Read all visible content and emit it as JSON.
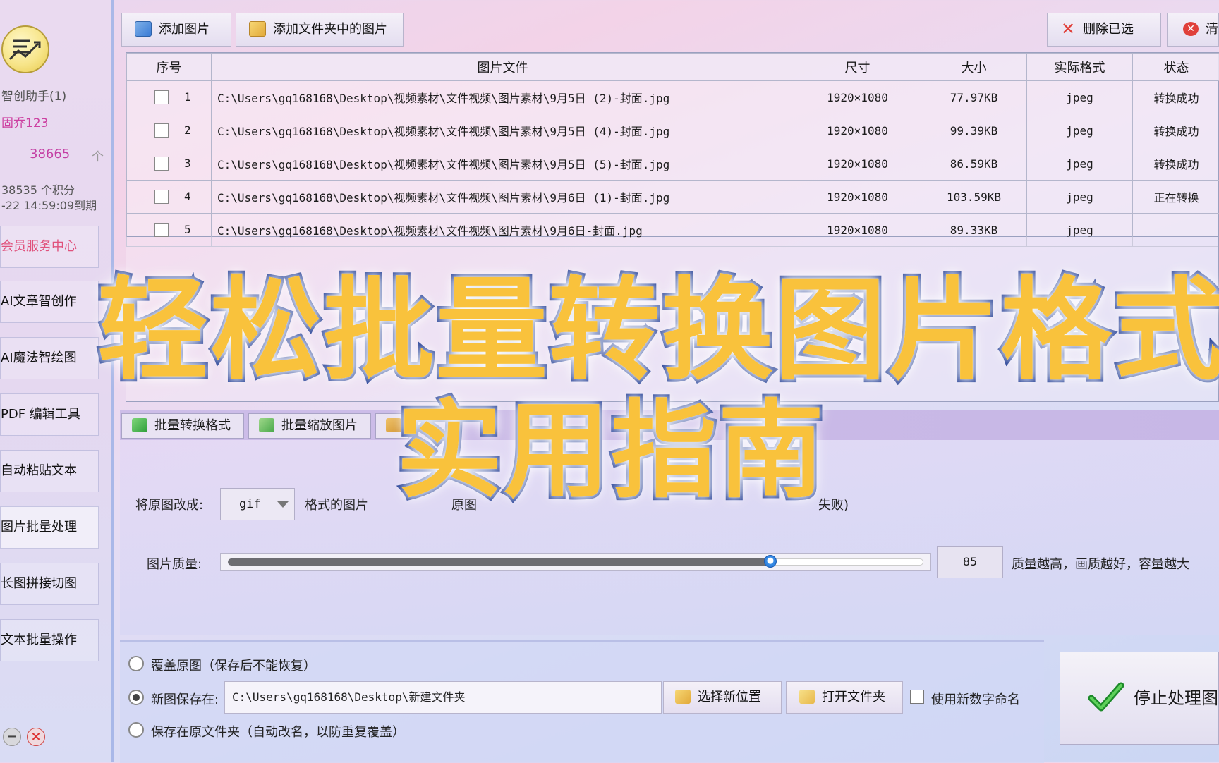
{
  "sidebar": {
    "app_name": "智创助手(1)",
    "user_name": "固乔123",
    "count": "38665",
    "count_unit": "个",
    "points": "38535 个积分",
    "expiry": "-22 14:59:09到期",
    "member_center": "会员服务中心",
    "items": [
      {
        "label": "AI文章智创作"
      },
      {
        "label": "AI魔法智绘图"
      },
      {
        "label": "PDF 编辑工具"
      },
      {
        "label": "自动粘贴文本"
      },
      {
        "label": "图片批量处理"
      },
      {
        "label": "长图拼接切图"
      },
      {
        "label": "文本批量操作"
      }
    ]
  },
  "toolbar": {
    "add_image": "添加图片",
    "add_folder": "添加文件夹中的图片",
    "delete_selected": "删除已选",
    "clear": "清"
  },
  "table": {
    "headers": [
      "序号",
      "图片文件",
      "尺寸",
      "大小",
      "实际格式",
      "状态"
    ],
    "rows": [
      {
        "no": "1",
        "file": "C:\\Users\\gq168168\\Desktop\\视频素材\\文件视频\\图片素材\\9月5日  (2)-封面.jpg",
        "size": "1920×1080",
        "bytes": "77.97KB",
        "format": "jpeg",
        "status": "转换成功"
      },
      {
        "no": "2",
        "file": "C:\\Users\\gq168168\\Desktop\\视频素材\\文件视频\\图片素材\\9月5日  (4)-封面.jpg",
        "size": "1920×1080",
        "bytes": "99.39KB",
        "format": "jpeg",
        "status": "转换成功"
      },
      {
        "no": "3",
        "file": "C:\\Users\\gq168168\\Desktop\\视频素材\\文件视频\\图片素材\\9月5日  (5)-封面.jpg",
        "size": "1920×1080",
        "bytes": "86.59KB",
        "format": "jpeg",
        "status": "转换成功"
      },
      {
        "no": "4",
        "file": "C:\\Users\\gq168168\\Desktop\\视频素材\\文件视频\\图片素材\\9月6日  (1)-封面.jpg",
        "size": "1920×1080",
        "bytes": "103.59KB",
        "format": "jpeg",
        "status": "正在转换"
      },
      {
        "no": "5",
        "file": "C:\\Users\\gq168168\\Desktop\\视频素材\\文件视频\\图片素材\\9月6日-封面.jpg",
        "size": "1920×1080",
        "bytes": "89.33KB",
        "format": "jpeg",
        "status": ""
      }
    ]
  },
  "tabs": {
    "batch_convert": "批量转换格式",
    "batch_resize": "批量缩放图片"
  },
  "settings": {
    "convert_label": "将原图改成:",
    "format_value": "gif",
    "format_suffix": "格式的图片",
    "partial_note_left": "原图",
    "partial_note_right": "失败)",
    "quality_label": "图片质量:",
    "quality_value": "85",
    "quality_fraction": 0.78,
    "quality_hint": "质量越高，画质越好，容量越大"
  },
  "save": {
    "overwrite": "覆盖原图（保存后不能恢复）",
    "save_new_label": "新图保存在:",
    "save_path": "C:\\Users\\gq168168\\Desktop\\新建文件夹",
    "choose_location": "选择新位置",
    "open_folder": "打开文件夹",
    "use_number_name": "使用新数字命名",
    "save_original": "保存在原文件夹（自动改名，以防重复覆盖）",
    "stop_button": "停止处理图"
  },
  "overlay": {
    "line1": "轻松批量转换图片格式",
    "line2": "实用指南"
  },
  "colors": {
    "overlay_fill": "#f9c23c",
    "overlay_stroke": "#1e3a93",
    "accent_pink": "#cc3fa0"
  }
}
